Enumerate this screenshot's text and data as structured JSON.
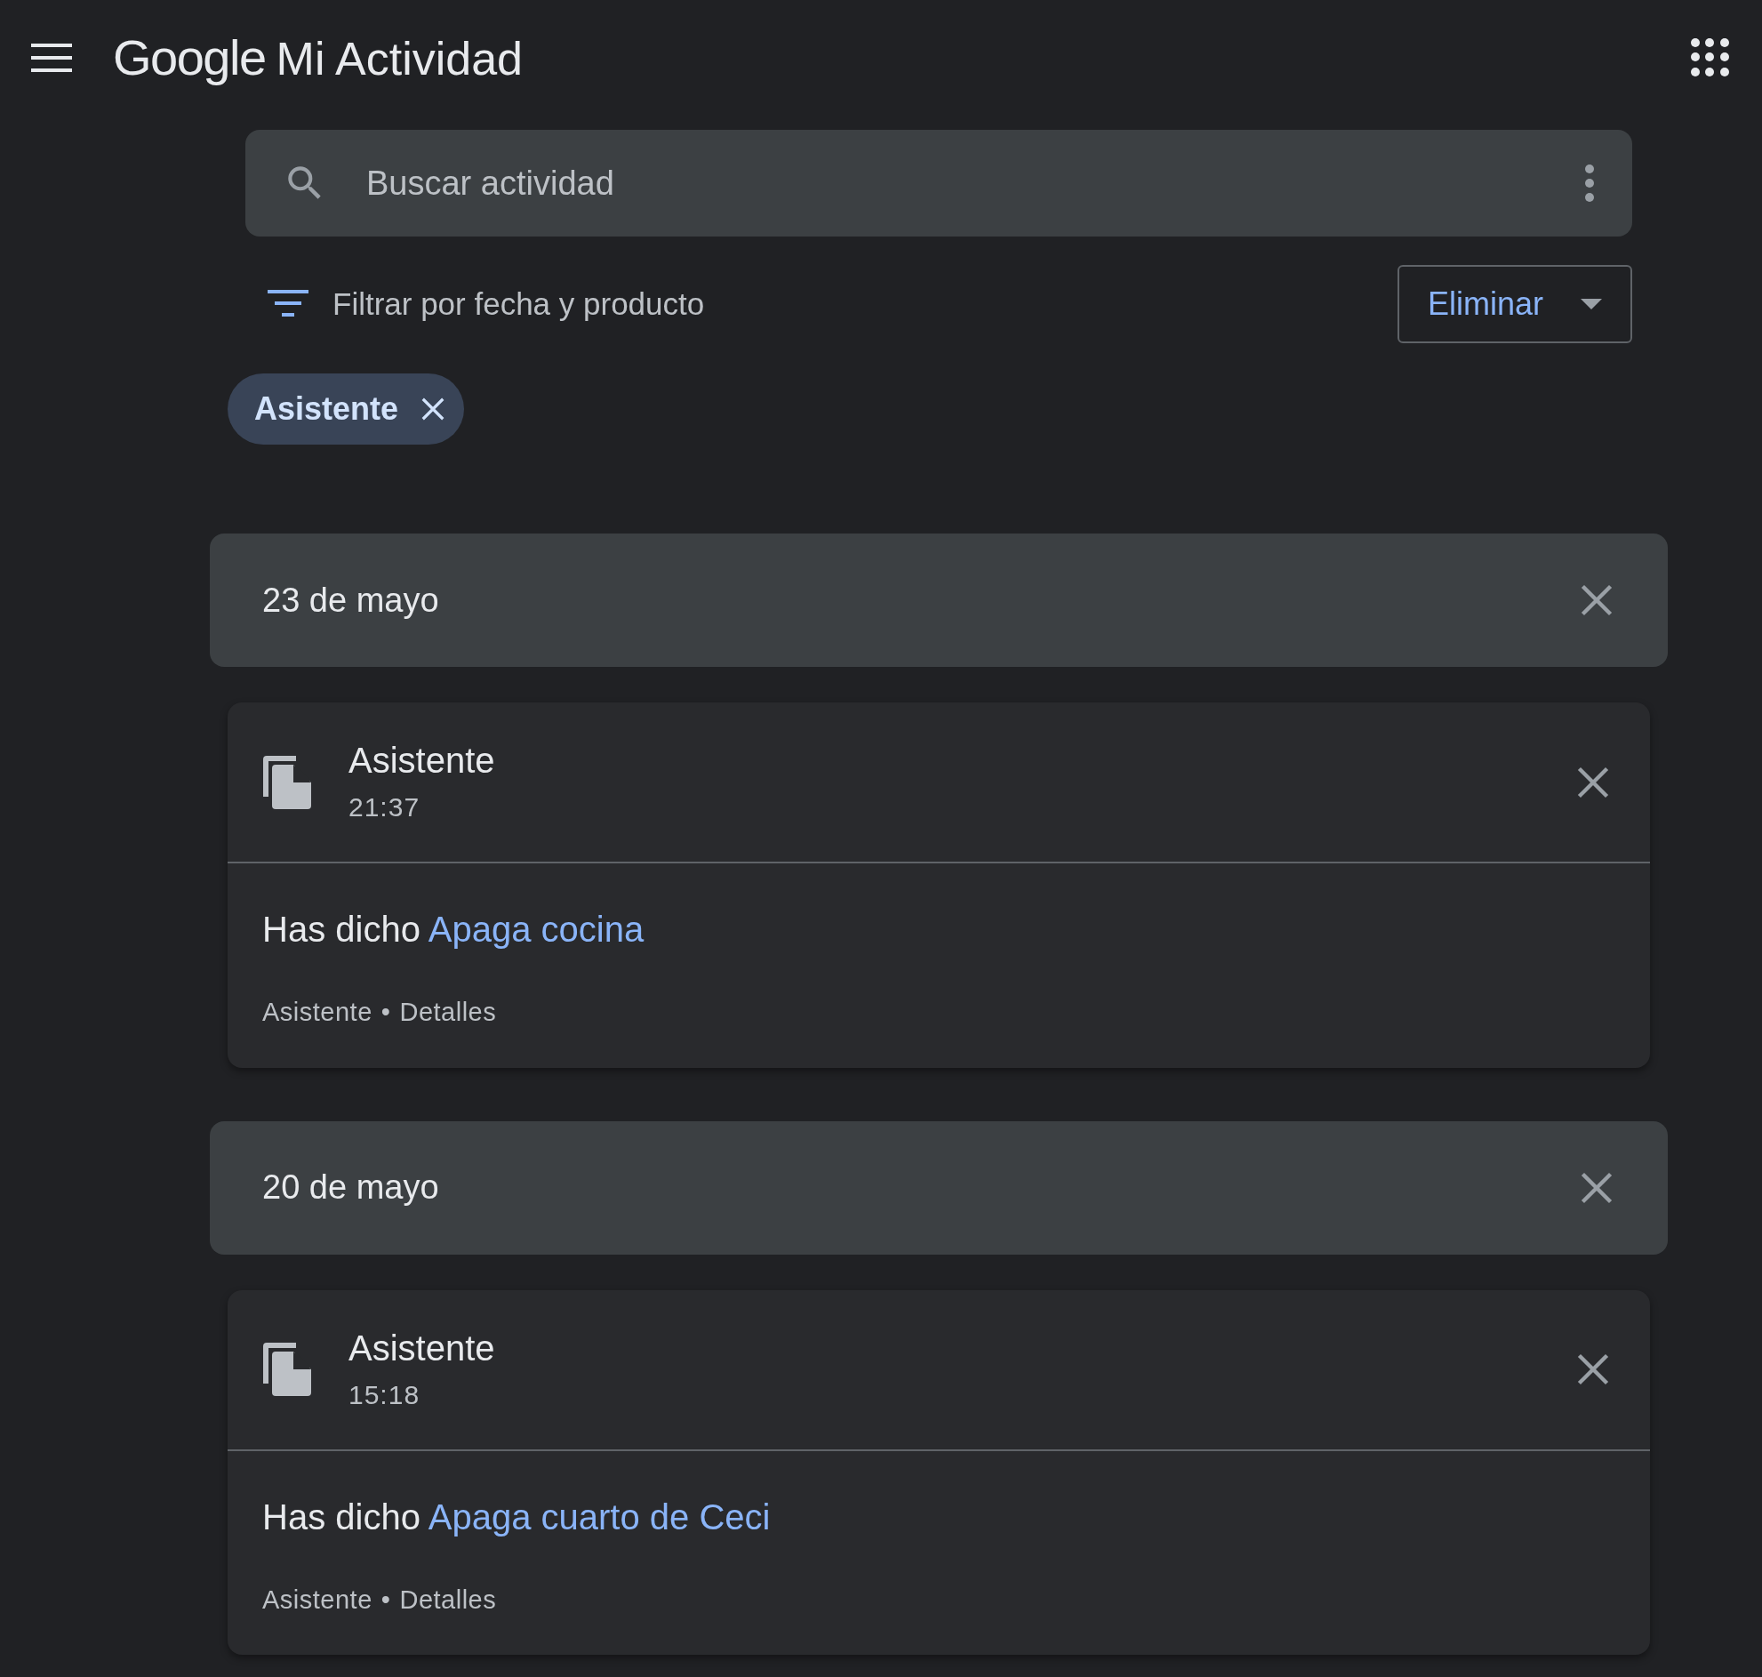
{
  "header": {
    "logo": "Google",
    "title": "Mi Actividad"
  },
  "search": {
    "placeholder": "Buscar actividad"
  },
  "filter": {
    "label": "Filtrar por fecha y producto"
  },
  "delete_button": {
    "label": "Eliminar"
  },
  "chips": [
    {
      "label": "Asistente"
    }
  ],
  "days": [
    {
      "date": "23 de mayo",
      "items": [
        {
          "product": "Asistente",
          "time": "21:37",
          "prefix": "Has dicho",
          "query": "Apaga cocina",
          "source": "Asistente",
          "separator": "•",
          "details": "Detalles"
        }
      ]
    },
    {
      "date": "20 de mayo",
      "items": [
        {
          "product": "Asistente",
          "time": "15:18",
          "prefix": "Has dicho",
          "query": "Apaga cuarto de Ceci",
          "source": "Asistente",
          "separator": "•",
          "details": "Detalles"
        }
      ]
    }
  ]
}
